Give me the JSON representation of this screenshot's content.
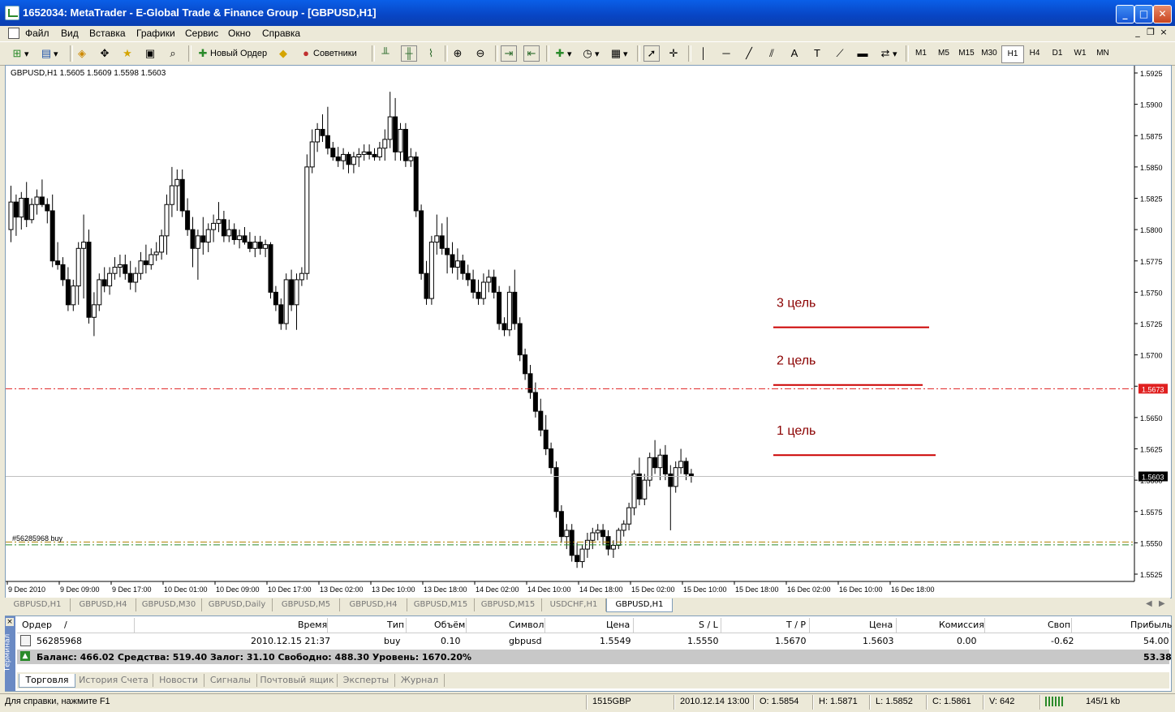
{
  "window": {
    "title": "1652034: MetaTrader - E-Global Trade & Finance Group - [GBPUSD,H1]"
  },
  "menu": [
    "Файл",
    "Вид",
    "Вставка",
    "Графики",
    "Сервис",
    "Окно",
    "Справка"
  ],
  "toolbar": {
    "new_order": "Новый Ордер",
    "advisors": "Советники",
    "timeframes": [
      "M1",
      "M5",
      "M15",
      "M30",
      "H1",
      "H4",
      "D1",
      "W1",
      "MN"
    ],
    "active_tf": "H1"
  },
  "chart": {
    "header": "GBPUSD,H1  1.5605 1.5609 1.5598 1.5603",
    "order_label": "#56285968 buy",
    "targets": [
      {
        "label": "3 цель",
        "price": 1.5722
      },
      {
        "label": "2 цель",
        "price": 1.5676
      },
      {
        "label": "1 цель",
        "price": 1.562
      }
    ],
    "price_badges": {
      "red": "1.5673",
      "current": "1.5603"
    }
  },
  "chart_data": {
    "type": "candlestick",
    "symbol": "GBPUSD",
    "timeframe": "H1",
    "ylim": [
      1.552,
      1.593
    ],
    "y_ticks": [
      "1.5925",
      "1.5900",
      "1.5875",
      "1.5850",
      "1.5825",
      "1.5800",
      "1.5775",
      "1.5750",
      "1.5725",
      "1.5700",
      "1.5675",
      "1.5650",
      "1.5625",
      "1.5600",
      "1.5575",
      "1.5550",
      "1.5525"
    ],
    "x_ticks": [
      "9 Dec 2010",
      "9 Dec 09:00",
      "9 Dec 17:00",
      "10 Dec 01:00",
      "10 Dec 09:00",
      "10 Dec 17:00",
      "13 Dec 02:00",
      "13 Dec 10:00",
      "13 Dec 18:00",
      "14 Dec 02:00",
      "14 Dec 10:00",
      "14 Dec 18:00",
      "15 Dec 02:00",
      "15 Dec 10:00",
      "15 Dec 18:00",
      "16 Dec 02:00",
      "16 Dec 10:00",
      "16 Dec 18:00"
    ],
    "levels": {
      "take_profit": 1.5673,
      "current_price": 1.5603,
      "open_price": 1.5549,
      "stop_loss": 1.555
    },
    "candles": [
      [
        1.58,
        1.5835,
        1.579,
        1.5822
      ],
      [
        1.5822,
        1.5828,
        1.5795,
        1.581
      ],
      [
        1.581,
        1.583,
        1.58,
        1.5825
      ],
      [
        1.5825,
        1.5838,
        1.5802,
        1.5808
      ],
      [
        1.5808,
        1.5825,
        1.5805,
        1.582
      ],
      [
        1.582,
        1.5832,
        1.5812,
        1.5826
      ],
      [
        1.5826,
        1.584,
        1.5818,
        1.582
      ],
      [
        1.582,
        1.5825,
        1.5805,
        1.5815
      ],
      [
        1.5815,
        1.5828,
        1.577,
        1.5775
      ],
      [
        1.5775,
        1.579,
        1.5768,
        1.5772
      ],
      [
        1.5772,
        1.5778,
        1.5755,
        1.576
      ],
      [
        1.576,
        1.577,
        1.5735,
        1.574
      ],
      [
        1.574,
        1.576,
        1.5735,
        1.5755
      ],
      [
        1.5755,
        1.579,
        1.574,
        1.5785
      ],
      [
        1.5785,
        1.5812,
        1.5745,
        1.579
      ],
      [
        1.579,
        1.58,
        1.5725,
        1.573
      ],
      [
        1.573,
        1.575,
        1.5715,
        1.574
      ],
      [
        1.574,
        1.5765,
        1.5735,
        1.576
      ],
      [
        1.576,
        1.577,
        1.575,
        1.5755
      ],
      [
        1.5755,
        1.577,
        1.5748,
        1.5765
      ],
      [
        1.5765,
        1.5778,
        1.576,
        1.577
      ],
      [
        1.577,
        1.578,
        1.5762,
        1.5772
      ],
      [
        1.5772,
        1.578,
        1.576,
        1.5765
      ],
      [
        1.5765,
        1.5775,
        1.5752,
        1.5758
      ],
      [
        1.5758,
        1.577,
        1.575,
        1.5765
      ],
      [
        1.5765,
        1.5782,
        1.576,
        1.5775
      ],
      [
        1.5775,
        1.5788,
        1.5765,
        1.5772
      ],
      [
        1.5772,
        1.5785,
        1.5768,
        1.578
      ],
      [
        1.578,
        1.579,
        1.5775,
        1.5782
      ],
      [
        1.5782,
        1.58,
        1.5776,
        1.5795
      ],
      [
        1.5795,
        1.5828,
        1.578,
        1.582
      ],
      [
        1.582,
        1.585,
        1.581,
        1.5835
      ],
      [
        1.5835,
        1.5848,
        1.5815,
        1.584
      ],
      [
        1.584,
        1.5848,
        1.581,
        1.5815
      ],
      [
        1.5815,
        1.5825,
        1.5795,
        1.58
      ],
      [
        1.58,
        1.581,
        1.577,
        1.5785
      ],
      [
        1.5785,
        1.58,
        1.576,
        1.5795
      ],
      [
        1.5795,
        1.581,
        1.578,
        1.579
      ],
      [
        1.579,
        1.5805,
        1.5782,
        1.58
      ],
      [
        1.58,
        1.5812,
        1.579,
        1.5805
      ],
      [
        1.5805,
        1.5822,
        1.5798,
        1.5808
      ],
      [
        1.5808,
        1.5815,
        1.579,
        1.5795
      ],
      [
        1.5795,
        1.5808,
        1.579,
        1.58
      ],
      [
        1.58,
        1.5805,
        1.5788,
        1.5792
      ],
      [
        1.5792,
        1.58,
        1.5785,
        1.5795
      ],
      [
        1.5795,
        1.5802,
        1.5788,
        1.579
      ],
      [
        1.579,
        1.5798,
        1.5782,
        1.5785
      ],
      [
        1.5785,
        1.5795,
        1.5778,
        1.579
      ],
      [
        1.579,
        1.5795,
        1.578,
        1.5785
      ],
      [
        1.5785,
        1.5792,
        1.5778,
        1.5788
      ],
      [
        1.5788,
        1.579,
        1.5745,
        1.575
      ],
      [
        1.575,
        1.5755,
        1.5735,
        1.574
      ],
      [
        1.574,
        1.5745,
        1.572,
        1.5725
      ],
      [
        1.5725,
        1.5765,
        1.572,
        1.576
      ],
      [
        1.576,
        1.5768,
        1.5735,
        1.574
      ],
      [
        1.574,
        1.5765,
        1.572,
        1.576
      ],
      [
        1.576,
        1.577,
        1.5755,
        1.5765
      ],
      [
        1.5765,
        1.586,
        1.576,
        1.585
      ],
      [
        1.585,
        1.588,
        1.5845,
        1.587
      ],
      [
        1.587,
        1.5885,
        1.5862,
        1.588
      ],
      [
        1.588,
        1.5892,
        1.587,
        1.5875
      ],
      [
        1.5875,
        1.5898,
        1.586,
        1.5865
      ],
      [
        1.5865,
        1.587,
        1.5855,
        1.5858
      ],
      [
        1.5858,
        1.5866,
        1.585,
        1.5855
      ],
      [
        1.5855,
        1.5865,
        1.5848,
        1.586
      ],
      [
        1.586,
        1.5862,
        1.5845,
        1.5852
      ],
      [
        1.5852,
        1.5862,
        1.5845,
        1.5858
      ],
      [
        1.5858,
        1.5865,
        1.585,
        1.586
      ],
      [
        1.586,
        1.5868,
        1.5855,
        1.5862
      ],
      [
        1.5862,
        1.5868,
        1.5856,
        1.586
      ],
      [
        1.586,
        1.5865,
        1.5855,
        1.5858
      ],
      [
        1.5858,
        1.587,
        1.5855,
        1.5865
      ],
      [
        1.5865,
        1.588,
        1.5855,
        1.5872
      ],
      [
        1.5872,
        1.591,
        1.5865,
        1.589
      ],
      [
        1.589,
        1.5905,
        1.5855,
        1.5862
      ],
      [
        1.5862,
        1.5885,
        1.5855,
        1.588
      ],
      [
        1.588,
        1.5885,
        1.585,
        1.5855
      ],
      [
        1.5855,
        1.5865,
        1.585,
        1.5858
      ],
      [
        1.5858,
        1.5862,
        1.581,
        1.5815
      ],
      [
        1.5815,
        1.582,
        1.576,
        1.5765
      ],
      [
        1.5765,
        1.5775,
        1.574,
        1.5745
      ],
      [
        1.5745,
        1.5795,
        1.574,
        1.579
      ],
      [
        1.579,
        1.5812,
        1.578,
        1.5795
      ],
      [
        1.5795,
        1.5805,
        1.578,
        1.5785
      ],
      [
        1.5785,
        1.581,
        1.5765,
        1.578
      ],
      [
        1.578,
        1.579,
        1.5765,
        1.577
      ],
      [
        1.577,
        1.5785,
        1.576,
        1.5775
      ],
      [
        1.5775,
        1.578,
        1.576,
        1.5765
      ],
      [
        1.5765,
        1.5772,
        1.5755,
        1.576
      ],
      [
        1.576,
        1.5768,
        1.5745,
        1.575
      ],
      [
        1.575,
        1.576,
        1.574,
        1.5745
      ],
      [
        1.5745,
        1.5765,
        1.574,
        1.5758
      ],
      [
        1.5758,
        1.5768,
        1.575,
        1.5762
      ],
      [
        1.5762,
        1.5768,
        1.5745,
        1.575
      ],
      [
        1.575,
        1.5755,
        1.572,
        1.5725
      ],
      [
        1.5725,
        1.573,
        1.5715,
        1.572
      ],
      [
        1.572,
        1.5755,
        1.5715,
        1.575
      ],
      [
        1.575,
        1.5768,
        1.572,
        1.5725
      ],
      [
        1.5725,
        1.573,
        1.5695,
        1.57
      ],
      [
        1.57,
        1.5705,
        1.568,
        1.5685
      ],
      [
        1.5685,
        1.5692,
        1.5665,
        1.567
      ],
      [
        1.567,
        1.5678,
        1.565,
        1.5655
      ],
      [
        1.5655,
        1.5665,
        1.5635,
        1.564
      ],
      [
        1.564,
        1.5652,
        1.562,
        1.5625
      ],
      [
        1.5625,
        1.563,
        1.5605,
        1.561
      ],
      [
        1.561,
        1.5615,
        1.557,
        1.5575
      ],
      [
        1.5575,
        1.558,
        1.555,
        1.5555
      ],
      [
        1.5555,
        1.5565,
        1.5545,
        1.556
      ],
      [
        1.556,
        1.5565,
        1.5535,
        1.554
      ],
      [
        1.554,
        1.555,
        1.553,
        1.5535
      ],
      [
        1.5535,
        1.5548,
        1.553,
        1.5545
      ],
      [
        1.5545,
        1.5558,
        1.5538,
        1.5552
      ],
      [
        1.5552,
        1.5562,
        1.5545,
        1.5558
      ],
      [
        1.5558,
        1.5565,
        1.5552,
        1.556
      ],
      [
        1.556,
        1.5565,
        1.5548,
        1.5555
      ],
      [
        1.5555,
        1.556,
        1.554,
        1.5545
      ],
      [
        1.5545,
        1.5552,
        1.5538,
        1.5548
      ],
      [
        1.5548,
        1.5562,
        1.5545,
        1.556
      ],
      [
        1.556,
        1.5568,
        1.5555,
        1.5565
      ],
      [
        1.5565,
        1.5582,
        1.556,
        1.5578
      ],
      [
        1.5578,
        1.5608,
        1.5572,
        1.5605
      ],
      [
        1.5605,
        1.5618,
        1.558,
        1.5585
      ],
      [
        1.5585,
        1.5605,
        1.558,
        1.56
      ],
      [
        1.56,
        1.5622,
        1.5595,
        1.5618
      ],
      [
        1.5618,
        1.5632,
        1.5605,
        1.561
      ],
      [
        1.561,
        1.5625,
        1.56,
        1.562
      ],
      [
        1.562,
        1.5628,
        1.56,
        1.5605
      ],
      [
        1.5605,
        1.5612,
        1.556,
        1.5595
      ],
      [
        1.5595,
        1.5615,
        1.559,
        1.561
      ],
      [
        1.561,
        1.5625,
        1.5605,
        1.5615
      ],
      [
        1.5615,
        1.5618,
        1.56,
        1.5605
      ],
      [
        1.5605,
        1.5609,
        1.5598,
        1.5603
      ]
    ]
  },
  "tabs": [
    "GBPUSD,H1",
    "GBPUSD,H4",
    "GBPUSD,M30",
    "GBPUSD,Daily",
    "GBPUSD,M5",
    "GBPUSD,H4",
    "GBPUSD,M15",
    "GBPUSD,M15",
    "USDCHF,H1",
    "GBPUSD,H1"
  ],
  "terminal": {
    "side": "Терминал",
    "headers": [
      "Ордер",
      "/",
      "Время",
      "Тип",
      "Объём",
      "Символ",
      "Цена",
      "S / L",
      "T / P",
      "Цена",
      "Комиссия",
      "Своп",
      "Прибыль"
    ],
    "row": {
      "order": "56285968",
      "time": "2010.12.15 21:37",
      "type": "buy",
      "volume": "0.10",
      "symbol": "gbpusd",
      "price": "1.5549",
      "sl": "1.5550",
      "tp": "1.5670",
      "cur": "1.5603",
      "commission": "0.00",
      "swap": "-0.62",
      "profit": "54.00"
    },
    "balance": "Баланс: 466.02  Средства: 519.40  Залог: 31.10  Свободно: 488.30  Уровень: 1670.20%",
    "balance_profit": "53.38",
    "tabs": [
      "Торговля",
      "История Счета",
      "Новости",
      "Сигналы",
      "Почтовый ящик",
      "Эксперты",
      "Журнал"
    ]
  },
  "status": {
    "help": "Для справки, нажмите F1",
    "profile": "1515GBP",
    "time": "2010.12.14 13:00",
    "o": "O: 1.5854",
    "h": "H: 1.5871",
    "l": "L: 1.5852",
    "c": "C: 1.5861",
    "v": "V: 642",
    "traffic": "145/1 kb"
  },
  "colors": {
    "bull": "#ffffff",
    "bear": "#000000",
    "target": "#cc0000",
    "stop": "#808000"
  }
}
